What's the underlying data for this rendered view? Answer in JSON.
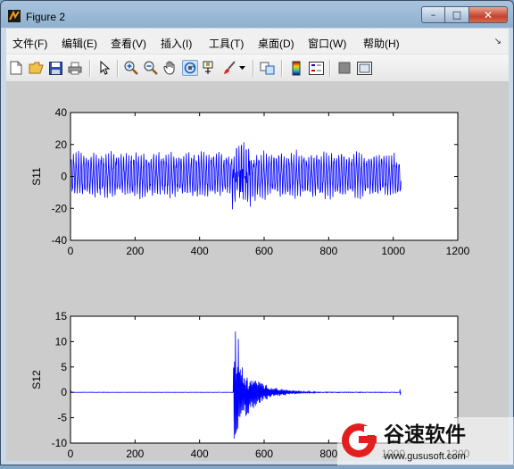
{
  "window": {
    "title": "Figure 2",
    "minimize": "–",
    "maximize": "□",
    "close": "✕"
  },
  "menu": [
    "文件(F)",
    "编辑(E)",
    "查看(V)",
    "插入(I)",
    "工具(T)",
    "桌面(D)",
    "窗口(W)",
    "帮助(H)"
  ],
  "menu_overflow": "↘",
  "toolbar": [
    "new-figure-icon",
    "open-file-icon",
    "save-icon",
    "print-icon",
    "pointer-icon",
    "zoom-in-icon",
    "zoom-out-icon",
    "pan-hand-icon",
    "rotate-3d-icon",
    "data-cursor-icon",
    "brush-icon",
    "brush-dropdown-icon",
    "link-plot-icon",
    "colorbar-icon",
    "legend-icon",
    "hide-plot-tools-icon",
    "show-plot-tools-icon"
  ],
  "chart_data": [
    {
      "type": "line",
      "ylabel": "S11",
      "xlim": [
        0,
        1200
      ],
      "ylim": [
        -40,
        40
      ],
      "xticks": [
        "0",
        "200",
        "400",
        "600",
        "800",
        "1000",
        "1200"
      ],
      "yticks": [
        "40",
        "20",
        "0",
        "-20",
        "-40"
      ],
      "series_color": "#0000ff",
      "x": [
        1,
        1024
      ],
      "y_range": [
        -25,
        30
      ]
    },
    {
      "type": "line",
      "ylabel": "S12",
      "xlim": [
        0,
        1200
      ],
      "ylim": [
        -10,
        15
      ],
      "xticks": [
        "0",
        "200",
        "400",
        "600",
        "800",
        "1000",
        "1200"
      ],
      "yticks": [
        "15",
        "10",
        "5",
        "0",
        "-5",
        "-10"
      ],
      "series_color": "#0000ff",
      "x": [
        1,
        1024
      ],
      "y_range": [
        -8,
        12
      ]
    }
  ],
  "watermark": {
    "brand": "谷速软件",
    "url": "www.gususoft.com"
  }
}
